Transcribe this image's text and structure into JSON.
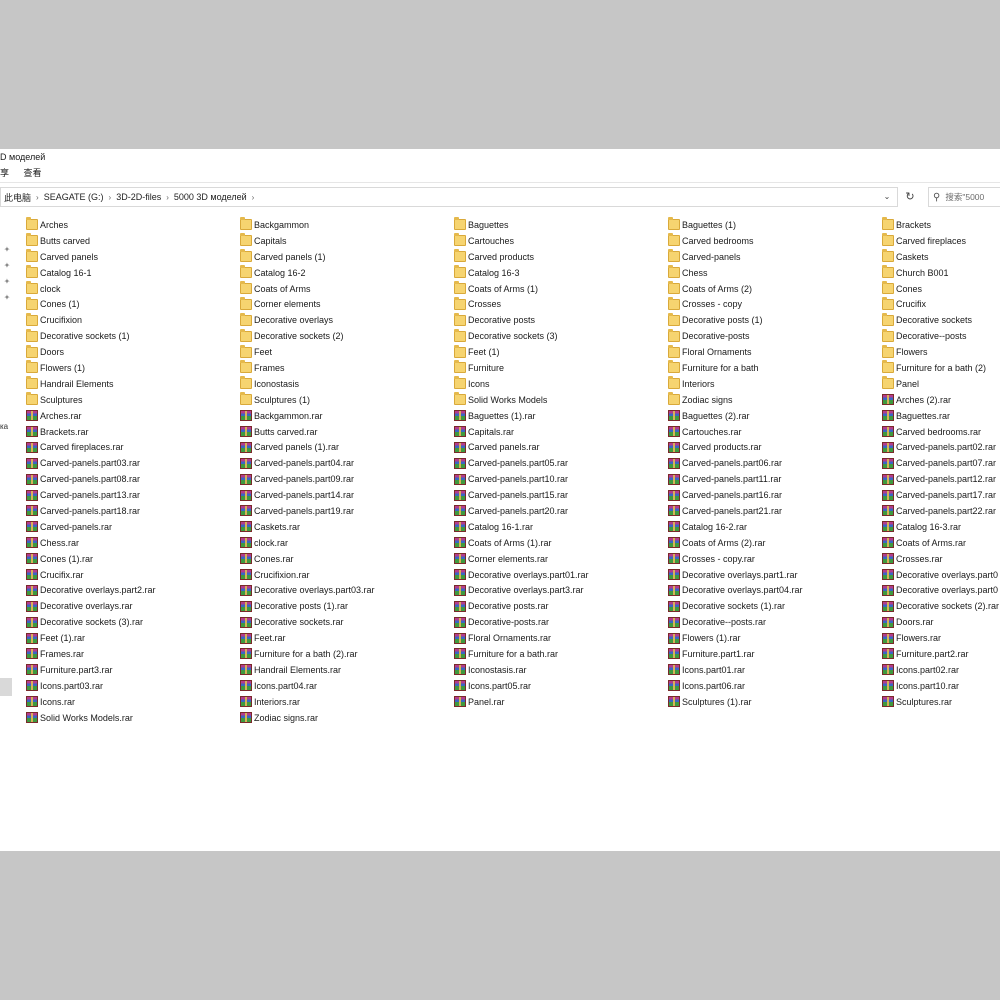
{
  "window": {
    "title_fragment": "D моделей",
    "menu_fragments": [
      "享",
      "查看"
    ]
  },
  "address_bar": {
    "crumbs": [
      "此电脑",
      "SEAGATE (G:)",
      "3D-2D-files",
      "5000 3D моделей"
    ]
  },
  "search": {
    "placeholder": "搜索\"5000"
  },
  "nav_pane": {
    "fragment": "ка"
  },
  "icons": {
    "folder": "folder-icon",
    "archive": "rar-archive-icon",
    "pin": "pin-icon",
    "refresh": "refresh-icon",
    "search": "search-icon",
    "dropdown": "chevron-down-icon"
  },
  "colors": {
    "folder": "#f6d470",
    "background": "#c6c6c6"
  },
  "files": [
    {
      "name": "Arches",
      "type": "folder"
    },
    {
      "name": "Backgammon",
      "type": "folder"
    },
    {
      "name": "Baguettes",
      "type": "folder"
    },
    {
      "name": "Baguettes (1)",
      "type": "folder"
    },
    {
      "name": "Brackets",
      "type": "folder"
    },
    {
      "name": "Butts carved",
      "type": "folder"
    },
    {
      "name": "Capitals",
      "type": "folder"
    },
    {
      "name": "Cartouches",
      "type": "folder"
    },
    {
      "name": "Carved bedrooms",
      "type": "folder"
    },
    {
      "name": "Carved fireplaces",
      "type": "folder"
    },
    {
      "name": "Carved panels",
      "type": "folder"
    },
    {
      "name": "Carved panels (1)",
      "type": "folder"
    },
    {
      "name": "Carved products",
      "type": "folder"
    },
    {
      "name": "Carved-panels",
      "type": "folder"
    },
    {
      "name": "Caskets",
      "type": "folder"
    },
    {
      "name": "Catalog 16-1",
      "type": "folder"
    },
    {
      "name": "Catalog 16-2",
      "type": "folder"
    },
    {
      "name": "Catalog 16-3",
      "type": "folder"
    },
    {
      "name": "Chess",
      "type": "folder"
    },
    {
      "name": "Church B001",
      "type": "folder"
    },
    {
      "name": "clock",
      "type": "folder"
    },
    {
      "name": "Coats of Arms",
      "type": "folder"
    },
    {
      "name": "Coats of Arms (1)",
      "type": "folder"
    },
    {
      "name": "Coats of Arms (2)",
      "type": "folder"
    },
    {
      "name": "Cones",
      "type": "folder"
    },
    {
      "name": "Cones (1)",
      "type": "folder"
    },
    {
      "name": "Corner elements",
      "type": "folder"
    },
    {
      "name": "Crosses",
      "type": "folder"
    },
    {
      "name": "Crosses - copy",
      "type": "folder"
    },
    {
      "name": "Crucifix",
      "type": "folder"
    },
    {
      "name": "Crucifixion",
      "type": "folder"
    },
    {
      "name": "Decorative overlays",
      "type": "folder"
    },
    {
      "name": "Decorative posts",
      "type": "folder"
    },
    {
      "name": "Decorative posts (1)",
      "type": "folder"
    },
    {
      "name": "Decorative sockets",
      "type": "folder"
    },
    {
      "name": "Decorative sockets (1)",
      "type": "folder"
    },
    {
      "name": "Decorative sockets (2)",
      "type": "folder"
    },
    {
      "name": "Decorative sockets (3)",
      "type": "folder"
    },
    {
      "name": "Decorative-posts",
      "type": "folder"
    },
    {
      "name": "Decorative--posts",
      "type": "folder"
    },
    {
      "name": "Doors",
      "type": "folder"
    },
    {
      "name": "Feet",
      "type": "folder"
    },
    {
      "name": "Feet (1)",
      "type": "folder"
    },
    {
      "name": "Floral Ornaments",
      "type": "folder"
    },
    {
      "name": "Flowers",
      "type": "folder"
    },
    {
      "name": "Flowers (1)",
      "type": "folder"
    },
    {
      "name": "Frames",
      "type": "folder"
    },
    {
      "name": "Furniture",
      "type": "folder"
    },
    {
      "name": "Furniture for a bath",
      "type": "folder"
    },
    {
      "name": "Furniture for a bath (2)",
      "type": "folder"
    },
    {
      "name": "Handrail Elements",
      "type": "folder"
    },
    {
      "name": "Iconostasis",
      "type": "folder"
    },
    {
      "name": "Icons",
      "type": "folder"
    },
    {
      "name": "Interiors",
      "type": "folder"
    },
    {
      "name": "Panel",
      "type": "folder"
    },
    {
      "name": "Sculptures",
      "type": "folder"
    },
    {
      "name": "Sculptures (1)",
      "type": "folder"
    },
    {
      "name": "Solid Works Models",
      "type": "folder"
    },
    {
      "name": "Zodiac signs",
      "type": "folder"
    },
    {
      "name": "Arches (2).rar",
      "type": "rar"
    },
    {
      "name": "Arches.rar",
      "type": "rar"
    },
    {
      "name": "Backgammon.rar",
      "type": "rar"
    },
    {
      "name": "Baguettes (1).rar",
      "type": "rar"
    },
    {
      "name": "Baguettes (2).rar",
      "type": "rar"
    },
    {
      "name": "Baguettes.rar",
      "type": "rar"
    },
    {
      "name": "Brackets.rar",
      "type": "rar"
    },
    {
      "name": "Butts carved.rar",
      "type": "rar"
    },
    {
      "name": "Capitals.rar",
      "type": "rar"
    },
    {
      "name": "Cartouches.rar",
      "type": "rar"
    },
    {
      "name": "Carved bedrooms.rar",
      "type": "rar"
    },
    {
      "name": "Carved fireplaces.rar",
      "type": "rar"
    },
    {
      "name": "Carved panels (1).rar",
      "type": "rar"
    },
    {
      "name": "Carved panels.rar",
      "type": "rar"
    },
    {
      "name": "Carved products.rar",
      "type": "rar"
    },
    {
      "name": "Carved-panels.part02.rar",
      "type": "rar"
    },
    {
      "name": "Carved-panels.part03.rar",
      "type": "rar"
    },
    {
      "name": "Carved-panels.part04.rar",
      "type": "rar"
    },
    {
      "name": "Carved-panels.part05.rar",
      "type": "rar"
    },
    {
      "name": "Carved-panels.part06.rar",
      "type": "rar"
    },
    {
      "name": "Carved-panels.part07.rar",
      "type": "rar"
    },
    {
      "name": "Carved-panels.part08.rar",
      "type": "rar"
    },
    {
      "name": "Carved-panels.part09.rar",
      "type": "rar"
    },
    {
      "name": "Carved-panels.part10.rar",
      "type": "rar"
    },
    {
      "name": "Carved-panels.part11.rar",
      "type": "rar"
    },
    {
      "name": "Carved-panels.part12.rar",
      "type": "rar"
    },
    {
      "name": "Carved-panels.part13.rar",
      "type": "rar"
    },
    {
      "name": "Carved-panels.part14.rar",
      "type": "rar"
    },
    {
      "name": "Carved-panels.part15.rar",
      "type": "rar"
    },
    {
      "name": "Carved-panels.part16.rar",
      "type": "rar"
    },
    {
      "name": "Carved-panels.part17.rar",
      "type": "rar"
    },
    {
      "name": "Carved-panels.part18.rar",
      "type": "rar"
    },
    {
      "name": "Carved-panels.part19.rar",
      "type": "rar"
    },
    {
      "name": "Carved-panels.part20.rar",
      "type": "rar"
    },
    {
      "name": "Carved-panels.part21.rar",
      "type": "rar"
    },
    {
      "name": "Carved-panels.part22.rar",
      "type": "rar"
    },
    {
      "name": "Carved-panels.rar",
      "type": "rar"
    },
    {
      "name": "Caskets.rar",
      "type": "rar"
    },
    {
      "name": "Catalog 16-1.rar",
      "type": "rar"
    },
    {
      "name": "Catalog 16-2.rar",
      "type": "rar"
    },
    {
      "name": "Catalog 16-3.rar",
      "type": "rar"
    },
    {
      "name": "Chess.rar",
      "type": "rar"
    },
    {
      "name": "clock.rar",
      "type": "rar"
    },
    {
      "name": "Coats of Arms (1).rar",
      "type": "rar"
    },
    {
      "name": "Coats of Arms (2).rar",
      "type": "rar"
    },
    {
      "name": "Coats of Arms.rar",
      "type": "rar"
    },
    {
      "name": "Cones (1).rar",
      "type": "rar"
    },
    {
      "name": "Cones.rar",
      "type": "rar"
    },
    {
      "name": "Corner elements.rar",
      "type": "rar"
    },
    {
      "name": "Crosses - copy.rar",
      "type": "rar"
    },
    {
      "name": "Crosses.rar",
      "type": "rar"
    },
    {
      "name": "Crucifix.rar",
      "type": "rar"
    },
    {
      "name": "Crucifixion.rar",
      "type": "rar"
    },
    {
      "name": "Decorative overlays.part01.rar",
      "type": "rar"
    },
    {
      "name": "Decorative overlays.part1.rar",
      "type": "rar"
    },
    {
      "name": "Decorative overlays.part0",
      "type": "rar"
    },
    {
      "name": "Decorative overlays.part2.rar",
      "type": "rar"
    },
    {
      "name": "Decorative overlays.part03.rar",
      "type": "rar"
    },
    {
      "name": "Decorative overlays.part3.rar",
      "type": "rar"
    },
    {
      "name": "Decorative overlays.part04.rar",
      "type": "rar"
    },
    {
      "name": "Decorative overlays.part0",
      "type": "rar"
    },
    {
      "name": "Decorative overlays.rar",
      "type": "rar"
    },
    {
      "name": "Decorative posts (1).rar",
      "type": "rar"
    },
    {
      "name": "Decorative posts.rar",
      "type": "rar"
    },
    {
      "name": "Decorative sockets (1).rar",
      "type": "rar"
    },
    {
      "name": "Decorative sockets (2).rar",
      "type": "rar"
    },
    {
      "name": "Decorative sockets (3).rar",
      "type": "rar"
    },
    {
      "name": "Decorative sockets.rar",
      "type": "rar"
    },
    {
      "name": "Decorative-posts.rar",
      "type": "rar"
    },
    {
      "name": "Decorative--posts.rar",
      "type": "rar"
    },
    {
      "name": "Doors.rar",
      "type": "rar"
    },
    {
      "name": "Feet (1).rar",
      "type": "rar"
    },
    {
      "name": "Feet.rar",
      "type": "rar"
    },
    {
      "name": "Floral Ornaments.rar",
      "type": "rar"
    },
    {
      "name": "Flowers (1).rar",
      "type": "rar"
    },
    {
      "name": "Flowers.rar",
      "type": "rar"
    },
    {
      "name": "Frames.rar",
      "type": "rar"
    },
    {
      "name": "Furniture for a bath (2).rar",
      "type": "rar"
    },
    {
      "name": "Furniture for a bath.rar",
      "type": "rar"
    },
    {
      "name": "Furniture.part1.rar",
      "type": "rar"
    },
    {
      "name": "Furniture.part2.rar",
      "type": "rar"
    },
    {
      "name": "Furniture.part3.rar",
      "type": "rar"
    },
    {
      "name": "Handrail Elements.rar",
      "type": "rar"
    },
    {
      "name": "Iconostasis.rar",
      "type": "rar"
    },
    {
      "name": "Icons.part01.rar",
      "type": "rar"
    },
    {
      "name": "Icons.part02.rar",
      "type": "rar"
    },
    {
      "name": "Icons.part03.rar",
      "type": "rar"
    },
    {
      "name": "Icons.part04.rar",
      "type": "rar"
    },
    {
      "name": "Icons.part05.rar",
      "type": "rar"
    },
    {
      "name": "Icons.part06.rar",
      "type": "rar"
    },
    {
      "name": "Icons.part10.rar",
      "type": "rar"
    },
    {
      "name": "Icons.rar",
      "type": "rar"
    },
    {
      "name": "Interiors.rar",
      "type": "rar"
    },
    {
      "name": "Panel.rar",
      "type": "rar"
    },
    {
      "name": "Sculptures (1).rar",
      "type": "rar"
    },
    {
      "name": "Sculptures.rar",
      "type": "rar"
    },
    {
      "name": "Solid Works Models.rar",
      "type": "rar"
    },
    {
      "name": "Zodiac signs.rar",
      "type": "rar"
    }
  ]
}
